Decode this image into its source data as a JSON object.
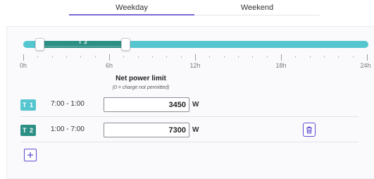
{
  "tabs": [
    {
      "label": "Weekday",
      "active": true
    },
    {
      "label": "Weekend",
      "active": false
    }
  ],
  "timeline": {
    "labels": [
      "0h",
      "6h",
      "12h",
      "18h",
      "24h"
    ],
    "segment_label": "T 2",
    "colors": {
      "t1": "#55c6cf",
      "t2": "#2c8f85"
    }
  },
  "limit": {
    "title": "Net power limit",
    "subtitle": "(0 = charge not permitted)",
    "unit": "W"
  },
  "rows": [
    {
      "badge": "T 1",
      "time": "7:00 - 1:00",
      "value": "3450",
      "unit": "W"
    },
    {
      "badge": "T 2",
      "time": "1:00 - 7:00",
      "value": "7300",
      "unit": "W"
    }
  ],
  "accent_color": "#5b4ad1"
}
